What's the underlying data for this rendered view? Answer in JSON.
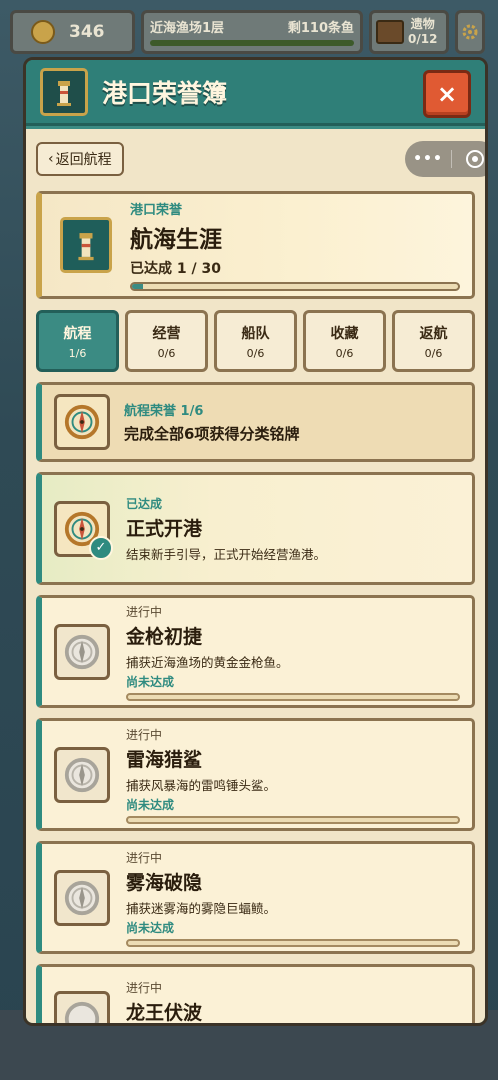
{
  "hud": {
    "coins": "346",
    "zone_name": "近海渔场1层",
    "zone_remaining": "剩110条鱼",
    "relics_label": "遗物",
    "relics_count": "0/12"
  },
  "modal": {
    "title": "港口荣誉簿",
    "close_label": "×",
    "back_label": "返回航程",
    "summary": {
      "kicker": "港口荣誉",
      "title": "航海生涯",
      "progress_text": "已达成 1 / 30",
      "progress_fraction": 0.033
    },
    "tabs": [
      {
        "label": "航程",
        "count": "1/6",
        "active": true
      },
      {
        "label": "经营",
        "count": "0/6",
        "active": false
      },
      {
        "label": "船队",
        "count": "0/6",
        "active": false
      },
      {
        "label": "收藏",
        "count": "0/6",
        "active": false
      },
      {
        "label": "返航",
        "count": "0/6",
        "active": false
      }
    ],
    "category": {
      "kicker": "航程荣誉 1/6",
      "desc": "完成全部6项获得分类铭牌"
    },
    "achievements": [
      {
        "status": "已达成",
        "title": "正式开港",
        "desc": "结束新手引导，正式开始经营渔港。",
        "done": true
      },
      {
        "status": "进行中",
        "title": "金枪初捷",
        "desc": "捕获近海渔场的黄金金枪鱼。",
        "progress_label": "尚未达成",
        "progress_fraction": 0,
        "done": false
      },
      {
        "status": "进行中",
        "title": "雷海猎鲨",
        "desc": "捕获风暴海的雷鸣锤头鲨。",
        "progress_label": "尚未达成",
        "progress_fraction": 0,
        "done": false
      },
      {
        "status": "进行中",
        "title": "雾海破隐",
        "desc": "捕获迷雾海的雾隐巨蝠鲼。",
        "progress_label": "尚未达成",
        "progress_fraction": 0,
        "done": false
      },
      {
        "status": "进行中",
        "title": "龙王伏波",
        "done": false
      }
    ],
    "icons": {
      "header": "lighthouse-book-icon",
      "category": "compass-icon",
      "achievement_done": "compass-icon",
      "achievement_locked": "compass-grey-icon",
      "check": "check-icon"
    }
  }
}
